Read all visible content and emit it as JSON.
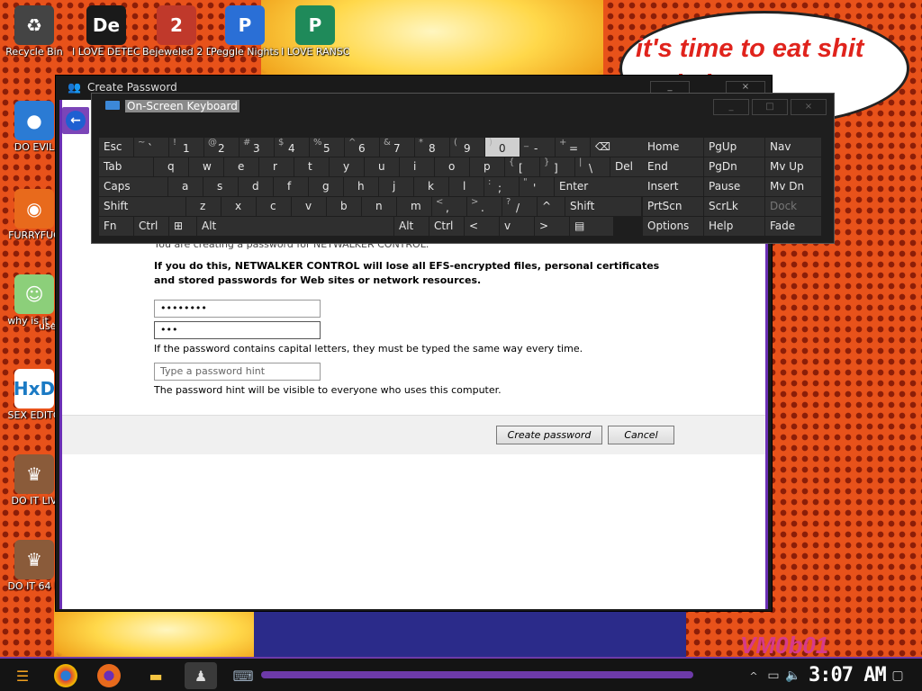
{
  "desktop": {
    "icons": [
      {
        "label": "Recycle Bin",
        "glyph": "♻",
        "color": "#444444"
      },
      {
        "label": "I LOVE DETECTING",
        "glyph": "De",
        "color": "#1a1a1a"
      },
      {
        "label": "Bejeweled 2 Deluxe",
        "glyph": "2",
        "color": "#c0392b"
      },
      {
        "label": "Peggle Nights Deluxe",
        "glyph": "P",
        "color": "#2a6fd6"
      },
      {
        "label": "I LOVE RANSOMWARE",
        "glyph": "P",
        "color": "#1f8a5a"
      },
      {
        "label": "DO EVIL",
        "glyph": "●",
        "color": "#2b7bd4"
      },
      {
        "label": "FURRYFUC",
        "glyph": "◉",
        "color": "#e86a1c"
      },
      {
        "label": "why is it ...",
        "glyph": "☺",
        "color": "#8ccf7a"
      },
      {
        "label": "SEX EDITO",
        "glyph": "HxD",
        "color": "#ffffff"
      },
      {
        "label": "DO IT LIV",
        "glyph": "♛",
        "color": "#8a5b3a"
      },
      {
        "label": "DO IT 64 B",
        "glyph": "♛",
        "color": "#8a5b3a"
      }
    ],
    "overlay_text_use": "use",
    "bubble_text": "it's time to eat shit and chew",
    "watermark": "VM0b01"
  },
  "dialog": {
    "title": "Create Password",
    "minimize": "_",
    "close": "×",
    "intro": "You are creating a password for NETWALKER CONTROL.",
    "warning": "If you do this, NETWALKER CONTROL will lose all EFS-encrypted files, personal certificates and stored passwords for Web sites or network resources.",
    "password_value": "••••••••",
    "confirm_value": "•••",
    "caps_note": "If the password contains capital letters, they must be typed the same way every time.",
    "hint_placeholder": "Type a password hint",
    "hint_note": "The password hint will be visible to everyone who uses this computer.",
    "create_label": "Create password",
    "cancel_label": "Cancel"
  },
  "osk": {
    "title": "On-Screen Keyboard",
    "min": "_",
    "max": "□",
    "close": "×",
    "rows": [
      [
        [
          "Esc",
          "",
          38
        ],
        [
          "~",
          "`",
          38
        ],
        [
          "!",
          "1",
          38
        ],
        [
          "@",
          "2",
          38
        ],
        [
          "#",
          "3",
          38
        ],
        [
          "$",
          "4",
          38
        ],
        [
          "%",
          "5",
          38
        ],
        [
          "^",
          "6",
          38
        ],
        [
          "&",
          "7",
          38
        ],
        [
          "*",
          "8",
          38
        ],
        [
          "(",
          "9",
          38
        ],
        [
          ")",
          "0",
          38,
          "hl"
        ],
        [
          "_",
          "-",
          38
        ],
        [
          "+",
          "=",
          38
        ],
        [
          "⌫",
          "",
          60
        ]
      ],
      [
        [
          "Tab",
          "",
          60
        ],
        [
          "",
          "q",
          38
        ],
        [
          "",
          "w",
          38
        ],
        [
          "",
          "e",
          38
        ],
        [
          "",
          "r",
          38
        ],
        [
          "",
          "t",
          38
        ],
        [
          "",
          "y",
          38
        ],
        [
          "",
          "u",
          38
        ],
        [
          "",
          "i",
          38
        ],
        [
          "",
          "o",
          38
        ],
        [
          "",
          "p",
          38
        ],
        [
          "{",
          "[",
          38
        ],
        [
          "}",
          "]",
          38
        ],
        [
          "|",
          "\\",
          38
        ],
        [
          "Del",
          "",
          38
        ]
      ],
      [
        [
          "Caps",
          "",
          76
        ],
        [
          "",
          "a",
          38
        ],
        [
          "",
          "s",
          38
        ],
        [
          "",
          "d",
          38
        ],
        [
          "",
          "f",
          38
        ],
        [
          "",
          "g",
          38
        ],
        [
          "",
          "h",
          38
        ],
        [
          "",
          "j",
          38
        ],
        [
          "",
          "k",
          38
        ],
        [
          "",
          "l",
          38
        ],
        [
          ":",
          ";",
          38
        ],
        [
          "\"",
          "'",
          38
        ],
        [
          "Enter",
          "",
          98
        ]
      ],
      [
        [
          "Shift",
          "",
          96
        ],
        [
          "",
          "z",
          38
        ],
        [
          "",
          "x",
          38
        ],
        [
          "",
          "c",
          38
        ],
        [
          "",
          "v",
          38
        ],
        [
          "",
          "b",
          38
        ],
        [
          "",
          "n",
          38
        ],
        [
          "",
          "m",
          38
        ],
        [
          "<",
          ",",
          38
        ],
        [
          ">",
          ".",
          38
        ],
        [
          "?",
          "/",
          38
        ],
        [
          "^",
          "",
          30
        ],
        [
          "Shift",
          "",
          84
        ]
      ],
      [
        [
          "Fn",
          "",
          38
        ],
        [
          "Ctrl",
          "",
          38
        ],
        [
          "⊞",
          "",
          30
        ],
        [
          "Alt",
          "",
          218
        ],
        [
          "Alt",
          "",
          38
        ],
        [
          "Ctrl",
          "",
          38
        ],
        [
          "<",
          "",
          38
        ],
        [
          "v",
          "",
          38
        ],
        [
          ">",
          "",
          38
        ],
        [
          "▤",
          "",
          48
        ]
      ]
    ],
    "side": [
      [
        "Home",
        "PgUp",
        "Nav"
      ],
      [
        "End",
        "PgDn",
        "Mv Up"
      ],
      [
        "Insert",
        "Pause",
        "Mv Dn"
      ],
      [
        "PrtScn",
        "ScrLk",
        "Dock"
      ],
      [
        "Options",
        "Help",
        "Fade"
      ]
    ]
  },
  "taskbar": {
    "clock": "3:07 AM"
  }
}
